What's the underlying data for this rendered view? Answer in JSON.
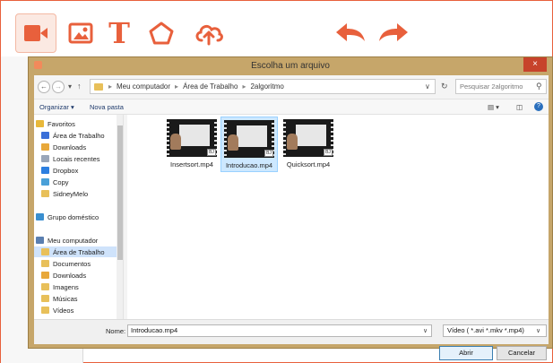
{
  "toolbar": {
    "tools": [
      {
        "icon": "video-icon"
      },
      {
        "icon": "image-icon"
      },
      {
        "icon": "text-icon",
        "glyph": "T"
      },
      {
        "icon": "pentagon-icon"
      },
      {
        "icon": "cloud-upload-icon"
      },
      {
        "icon": "undo-icon"
      },
      {
        "icon": "redo-icon"
      }
    ],
    "accent_color": "#e8603c"
  },
  "dialog": {
    "title": "Escolha um arquivo",
    "close_glyph": "×",
    "address": {
      "back_glyph": "←",
      "forward_glyph": "→",
      "history_glyph": "▾",
      "up_glyph": "↑",
      "crumbs": [
        "Meu computador",
        "Área de Trabalho",
        "2algoritmo"
      ],
      "separator": "▸",
      "dropdown_glyph": "∨",
      "refresh_glyph": "↻"
    },
    "search": {
      "placeholder": "Pesquisar 2algoritmo",
      "icon_glyph": "⚲"
    },
    "commands": {
      "organize": "Organizar ▾",
      "new_folder": "Nova pasta",
      "view_glyph": "▤ ▾",
      "preview_glyph": "◫",
      "help_glyph": "?"
    },
    "nav": [
      {
        "label": "Favoritos",
        "icon": "star-icon",
        "color": "#e8b83a"
      },
      {
        "label": "Área de Trabalho",
        "icon": "desktop-icon",
        "color": "#3a6fd8"
      },
      {
        "label": "Downloads",
        "icon": "downloads-icon",
        "color": "#e8a83a"
      },
      {
        "label": "Locais recentes",
        "icon": "recent-icon",
        "color": "#9aa6b8"
      },
      {
        "label": "Dropbox",
        "icon": "dropbox-icon",
        "color": "#2d7fe0"
      },
      {
        "label": "Copy",
        "icon": "copy-icon",
        "color": "#4aa0d8"
      },
      {
        "label": "SidneyMelo",
        "icon": "folder-icon",
        "color": "#e8c05a"
      },
      {
        "label": "Grupo doméstico",
        "icon": "homegroup-icon",
        "color": "#3a8fd0"
      },
      {
        "label": "Meu computador",
        "icon": "computer-icon",
        "color": "#5a7fb0"
      },
      {
        "label": "Área de Trabalho",
        "icon": "desktop-folder-icon",
        "color": "#e8c05a"
      },
      {
        "label": "Documentos",
        "icon": "documents-icon",
        "color": "#e8c05a"
      },
      {
        "label": "Downloads",
        "icon": "downloads-folder-icon",
        "color": "#e8a83a"
      },
      {
        "label": "Imagens",
        "icon": "images-icon",
        "color": "#e8c05a"
      },
      {
        "label": "Músicas",
        "icon": "music-icon",
        "color": "#e8c05a"
      },
      {
        "label": "Vídeos",
        "icon": "videos-icon",
        "color": "#e8c05a"
      }
    ],
    "files": [
      {
        "name": "Insertsort.mp4",
        "badge": "BJ",
        "selected": false
      },
      {
        "name": "Introducao.mp4",
        "badge": "BJ",
        "selected": true
      },
      {
        "name": "Quicksort.mp4",
        "badge": "BJ",
        "selected": false
      }
    ],
    "filename_label": "Nome:",
    "filename_value": "Introducao.mp4",
    "filetype_value": "Vídeo ( *.avi *.mkv *.mp4)",
    "open_label": "Abrir",
    "cancel_label": "Cancelar"
  }
}
